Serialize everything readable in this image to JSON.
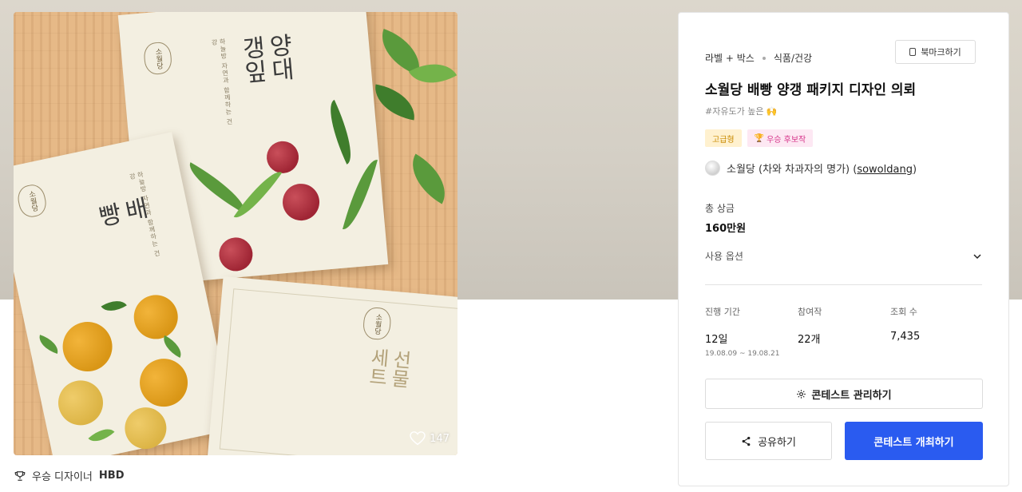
{
  "hero": {
    "likes_count": "147",
    "card_a": {
      "seal": "소월당",
      "title": "양대\n갱잎",
      "caption": "하늘방 자연과 함께하는 건강"
    },
    "card_b": {
      "seal": "소월당",
      "title": "배\n빵",
      "caption": "하늘방 자연과 함께하는 건강"
    },
    "card_c": {
      "seal": "소월당",
      "title": "선물\n세트"
    }
  },
  "winner_line": {
    "prefix": "우승 디자이너",
    "name": "HBD"
  },
  "panel": {
    "category": "라벨 + 박스",
    "subcategory": "식품/건강",
    "bookmark_label": "북마크하기",
    "title": "소월당 배빵 양갱 패키지 디자인 의뢰",
    "hashtag": "#자유도가 높은 🙌",
    "tags": {
      "premium": "고급형",
      "candidate": "우승 후보작"
    },
    "holder": {
      "name": "소월당 (차와 차과자의 명가)",
      "id_open": "(",
      "id": "sowoldang",
      "id_close": ")"
    },
    "prize_label": "총 상금",
    "prize_value": "160만원",
    "usage_label": "사용 옵션",
    "stats": {
      "period_label": "진행 기간",
      "period_value": "12일",
      "period_range": "19.08.09 ~ 19.08.21",
      "entries_label": "참여작",
      "entries_value": "22개",
      "views_label": "조회 수",
      "views_value": "7,435"
    },
    "manage_label": "콘테스트 관리하기",
    "share_label": "공유하기",
    "host_label": "콘테스트 개최하기"
  },
  "colors": {
    "primary_button": "#2a5bf0",
    "premium_tag_bg": "#fff1cf",
    "premium_tag_text": "#c98a00",
    "candidate_tag_bg": "#fde8f3",
    "candidate_tag_text": "#d6338a"
  },
  "icons": {
    "likes": "heart-icon",
    "winner": "trophy-icon",
    "bookmark": "bookmark-icon",
    "usage": "chevron-down-icon",
    "manage": "gear-icon",
    "share": "share-icon"
  }
}
